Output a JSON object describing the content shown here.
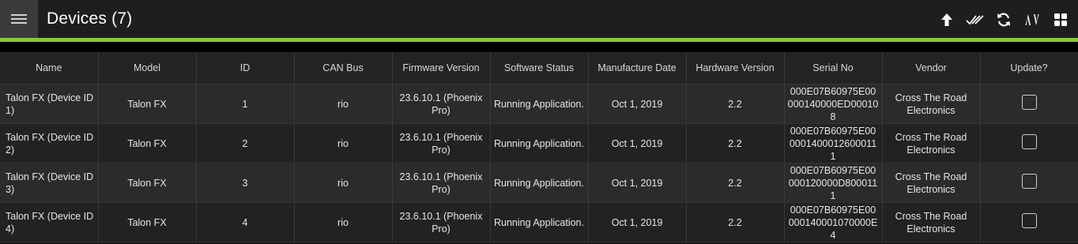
{
  "header": {
    "title": "Devices (7)"
  },
  "toolbar": {
    "icons": [
      "upload-arrow-icon",
      "double-check-icon",
      "refresh-icon",
      "sort-icon",
      "grid-view-icon"
    ]
  },
  "colors": {
    "accent": "#8cc63f",
    "background": "#1b1b1b",
    "row_odd": "#2b2b2b",
    "row_even": "#222222"
  },
  "table": {
    "columns": [
      "Name",
      "Model",
      "ID",
      "CAN Bus",
      "Firmware Version",
      "Software Status",
      "Manufacture Date",
      "Hardware Version",
      "Serial No",
      "Vendor",
      "Update?"
    ],
    "rows": [
      {
        "name": "Talon FX (Device ID 1)",
        "model": "Talon FX",
        "id": "1",
        "can_bus": "rio",
        "firmware": "23.6.10.1 (Phoenix Pro)",
        "status": "Running Application.",
        "date": "Oct 1, 2019",
        "hardware": "2.2",
        "serial": "000E07B60975E00000140000ED000108",
        "vendor": "Cross The Road Electronics",
        "update": false
      },
      {
        "name": "Talon FX (Device ID 2)",
        "model": "Talon FX",
        "id": "2",
        "can_bus": "rio",
        "firmware": "23.6.10.1 (Phoenix Pro)",
        "status": "Running Application.",
        "date": "Oct 1, 2019",
        "hardware": "2.2",
        "serial": "000E07B60975E0000014000126000111",
        "vendor": "Cross The Road Electronics",
        "update": false
      },
      {
        "name": "Talon FX (Device ID 3)",
        "model": "Talon FX",
        "id": "3",
        "can_bus": "rio",
        "firmware": "23.6.10.1 (Phoenix Pro)",
        "status": "Running Application.",
        "date": "Oct 1, 2019",
        "hardware": "2.2",
        "serial": "000E07B60975E00000120000D8000111",
        "vendor": "Cross The Road Electronics",
        "update": false
      },
      {
        "name": "Talon FX (Device ID 4)",
        "model": "Talon FX",
        "id": "4",
        "can_bus": "rio",
        "firmware": "23.6.10.1 (Phoenix Pro)",
        "status": "Running Application.",
        "date": "Oct 1, 2019",
        "hardware": "2.2",
        "serial": "000E07B60975E00000140001070000E4",
        "vendor": "Cross The Road Electronics",
        "update": false
      }
    ]
  }
}
